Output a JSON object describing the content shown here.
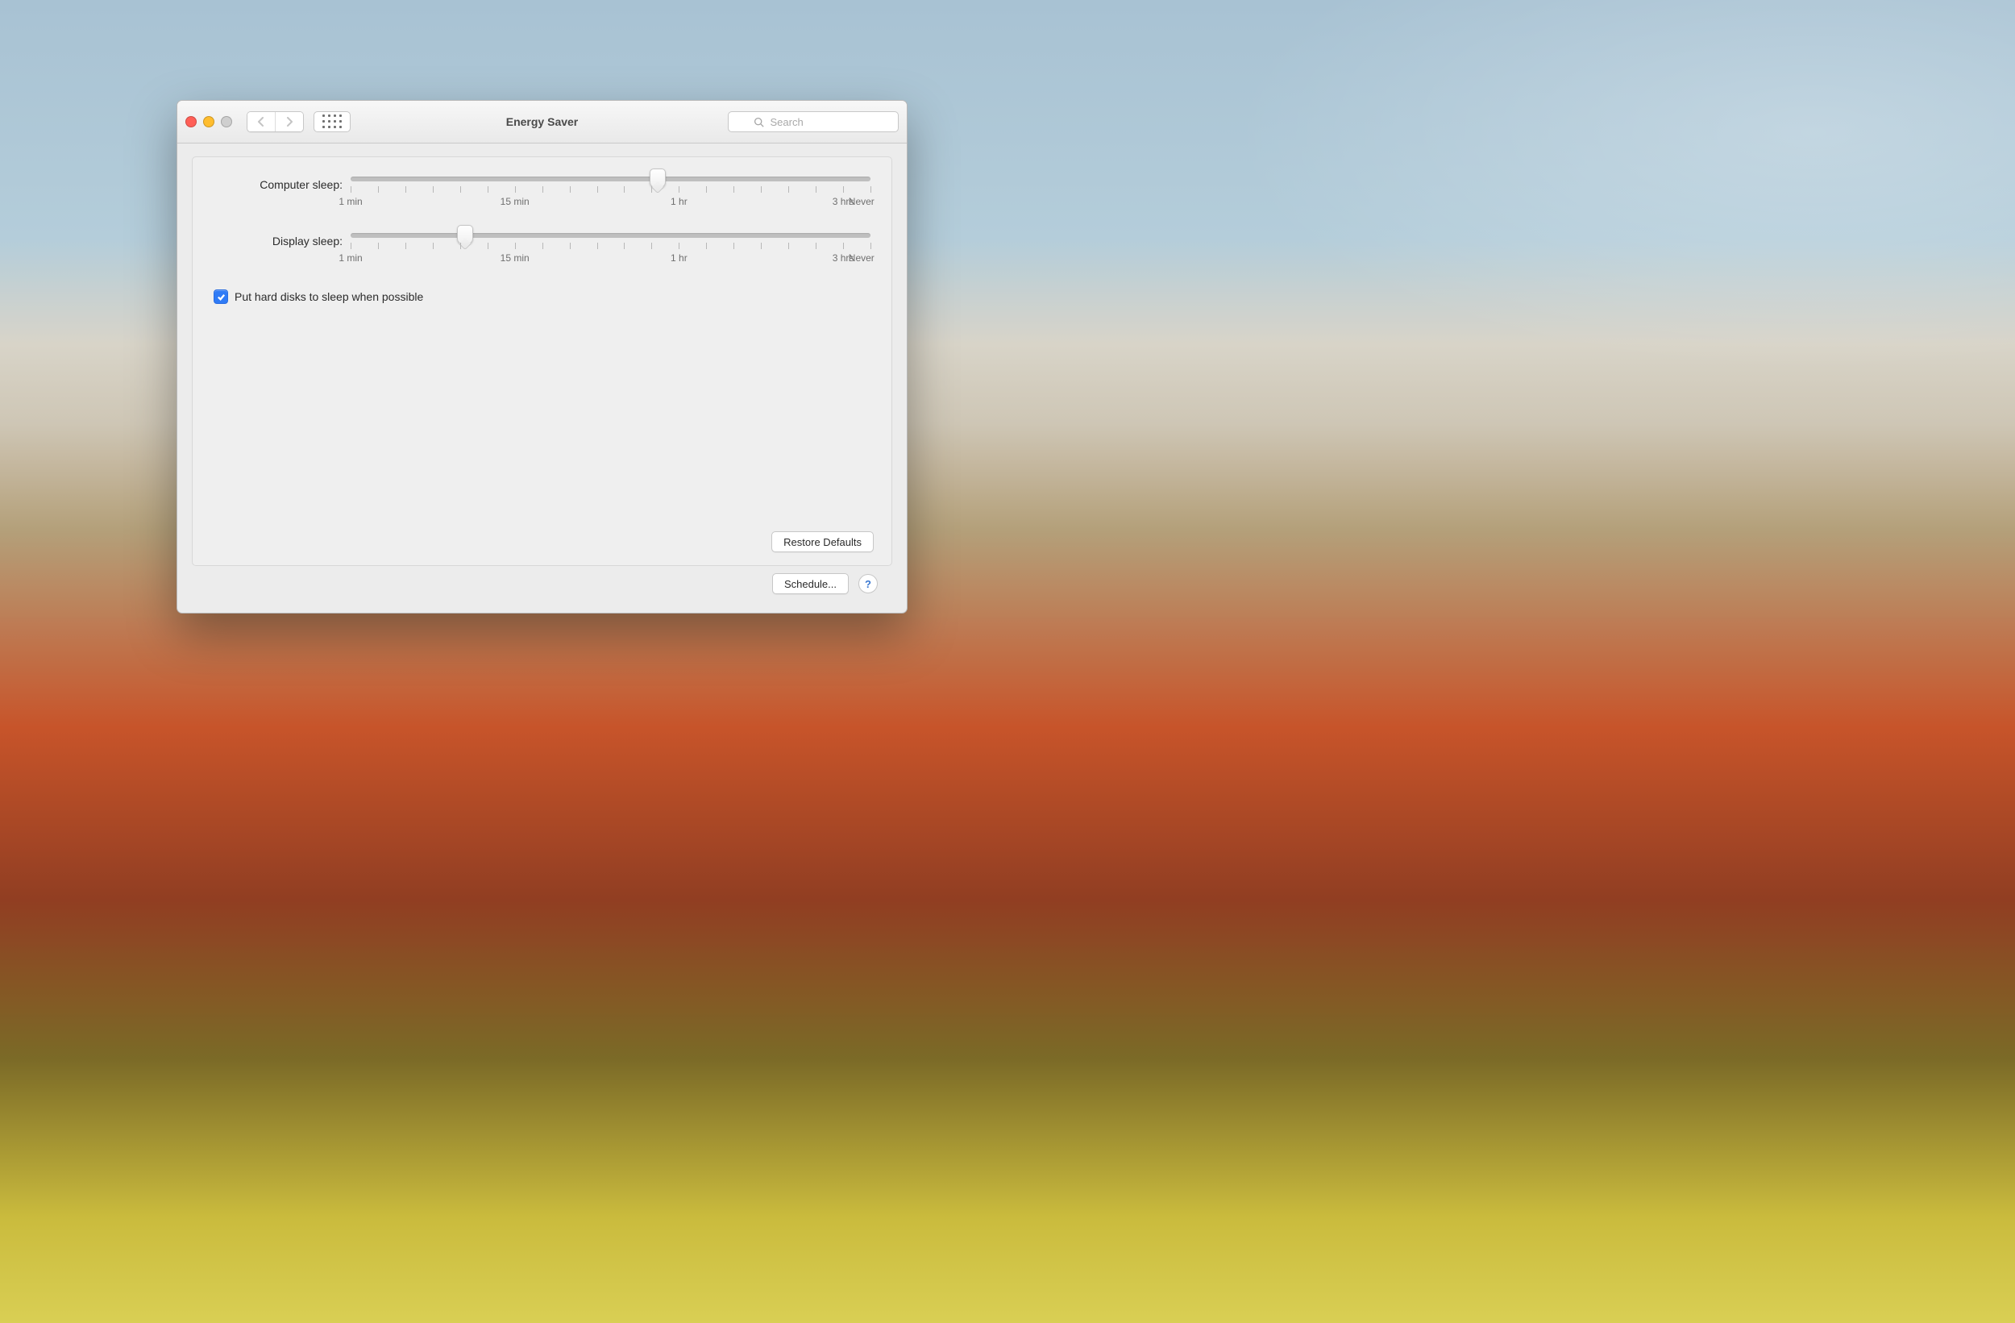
{
  "window": {
    "title": "Energy Saver"
  },
  "search": {
    "placeholder": "Search"
  },
  "sliders": {
    "computer": {
      "label": "Computer sleep:",
      "position_pct": 59
    },
    "display": {
      "label": "Display sleep:",
      "position_pct": 22
    },
    "tick_labels": {
      "t0": "1 min",
      "t6": "15 min",
      "t12": "1 hr",
      "t18": "3 hrs",
      "t19": "Never"
    }
  },
  "checkbox": {
    "hard_disks": {
      "label": "Put hard disks to sleep when possible",
      "checked": true
    }
  },
  "buttons": {
    "restore_defaults": "Restore Defaults",
    "schedule": "Schedule...",
    "help": "?"
  }
}
